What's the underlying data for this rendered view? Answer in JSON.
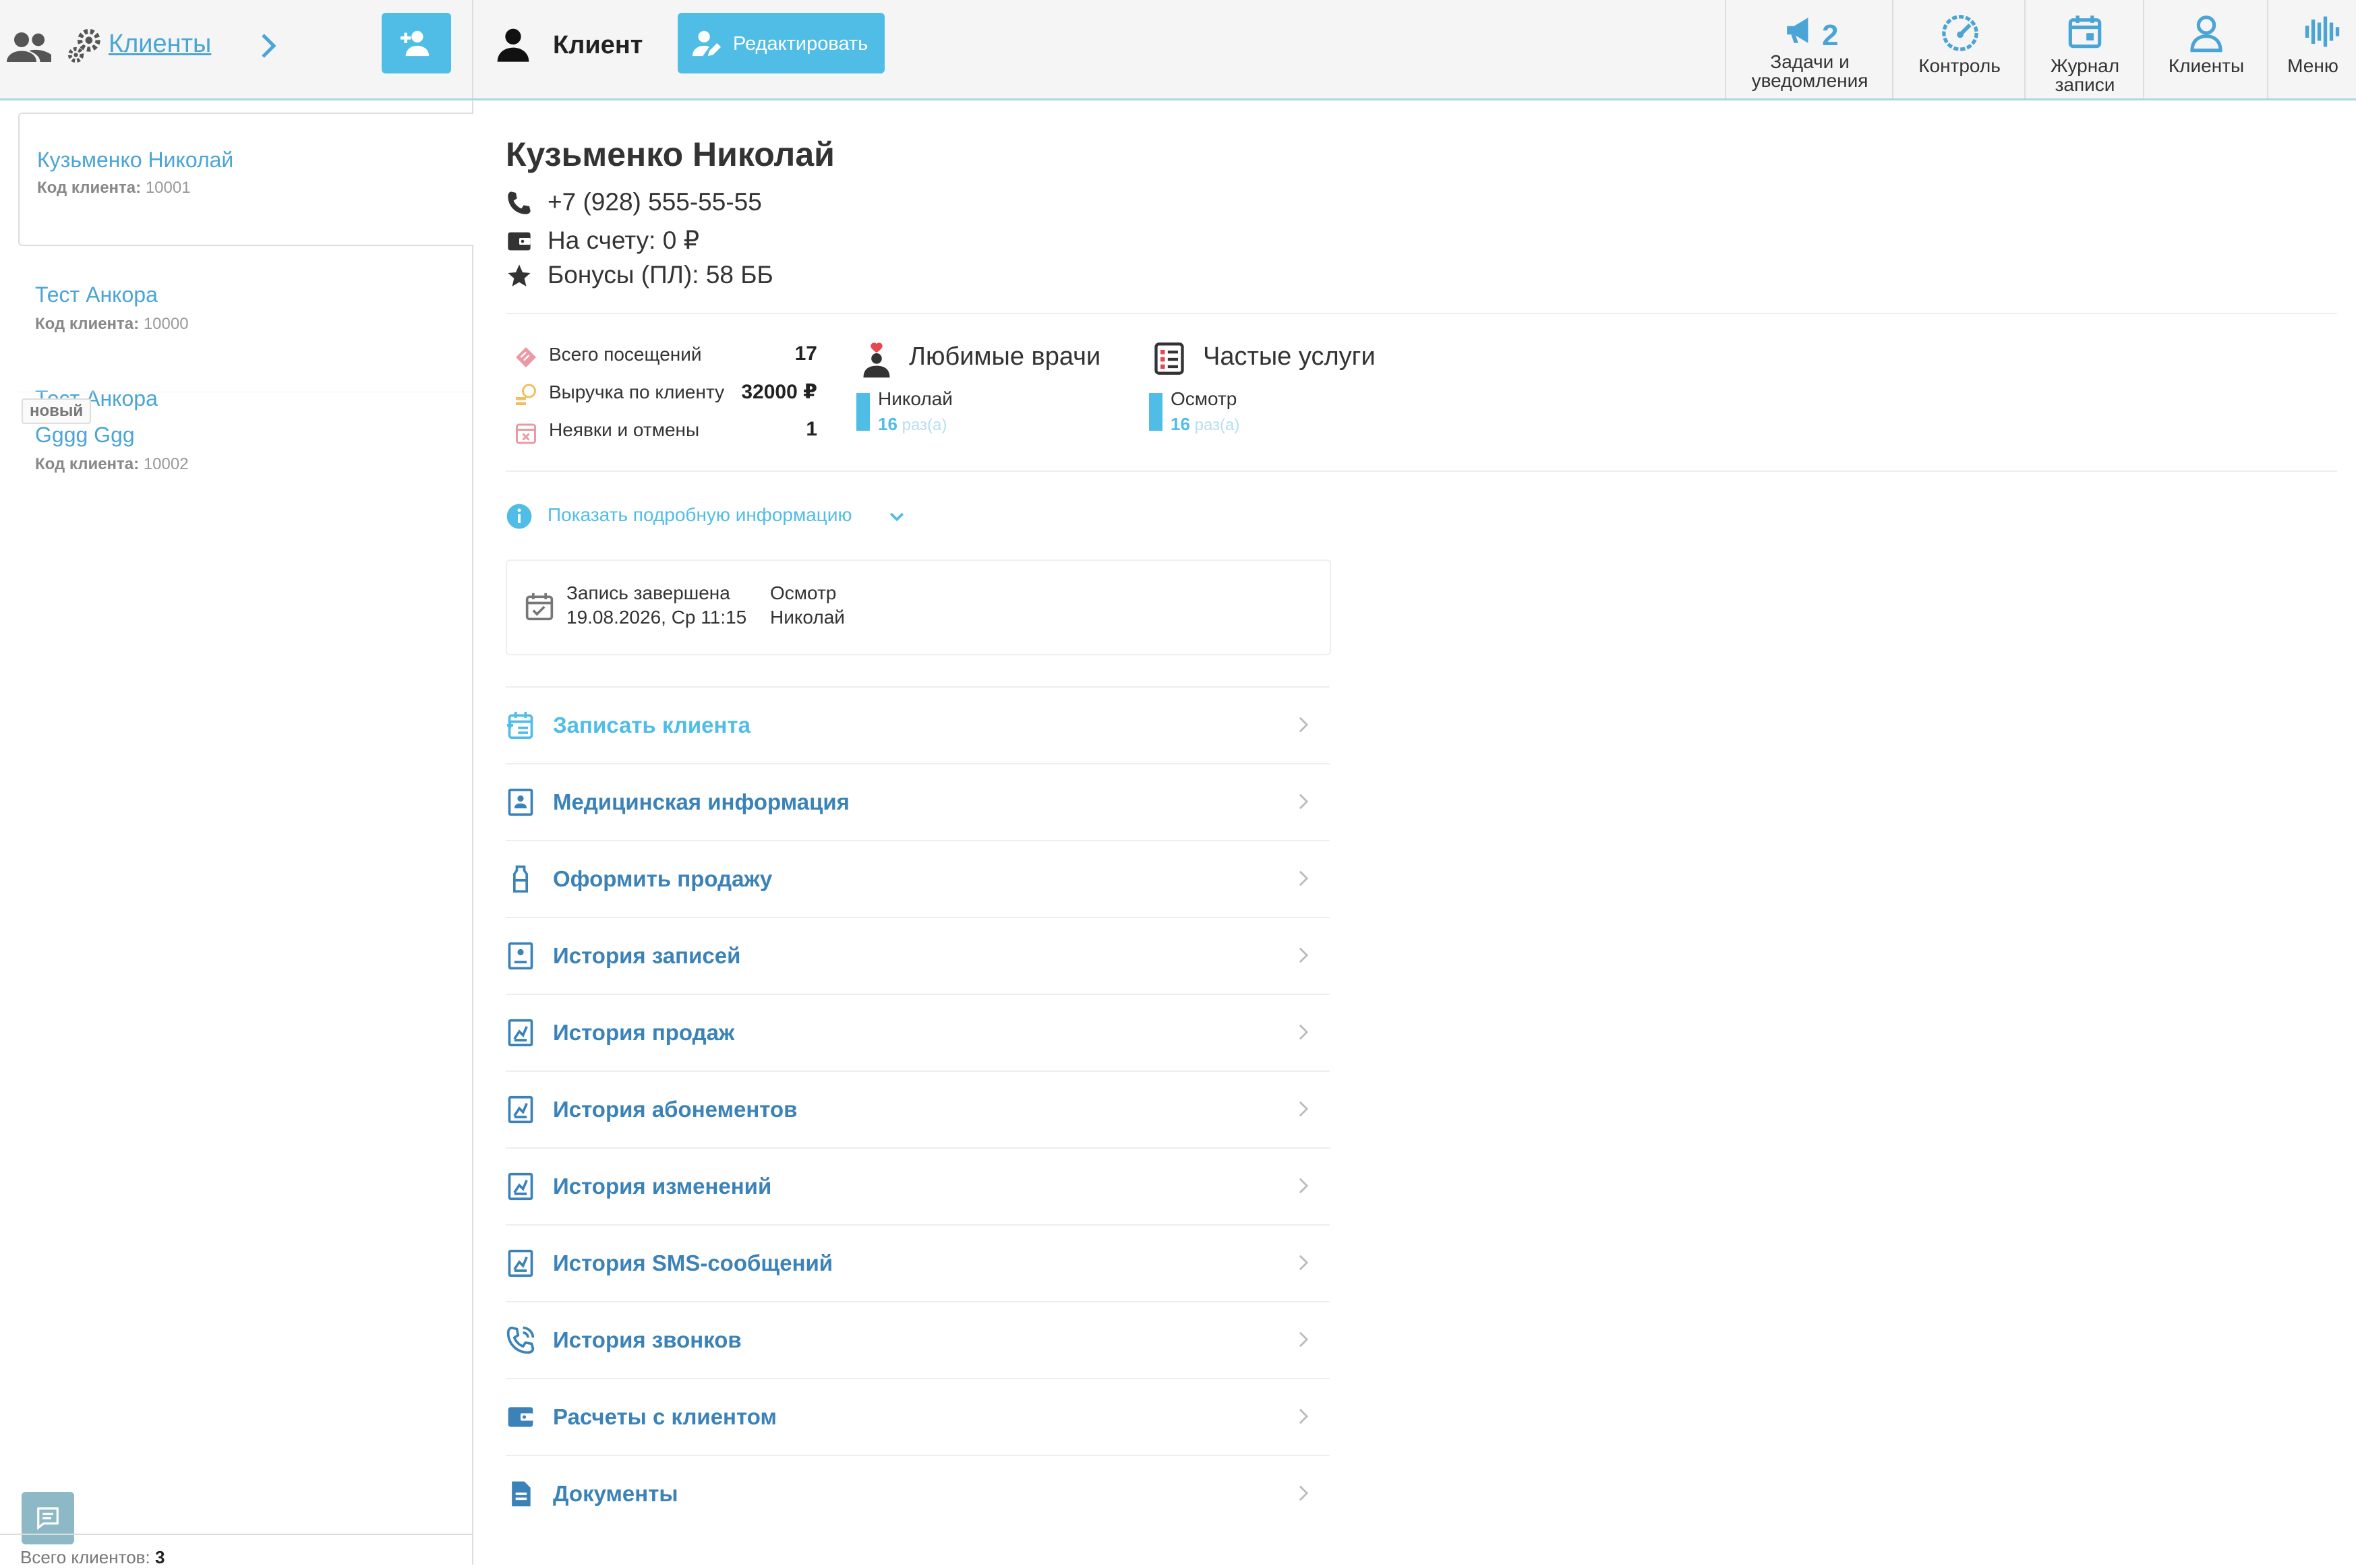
{
  "topbar": {
    "section_title": "Клиенты",
    "client_header": "Клиент",
    "edit_button": "Редактировать",
    "nav": {
      "tasks_count": "2",
      "tasks_line1": "Задачи и",
      "tasks_line2": "уведомления",
      "control": "Контроль",
      "journal_line1": "Журнал",
      "journal_line2": "записи",
      "clients": "Клиенты",
      "menu": "Меню"
    }
  },
  "sidebar": {
    "code_label": "Код клиента:",
    "clients": [
      {
        "name": "Кузьменко Николай",
        "code": "10001"
      },
      {
        "name": "Тест Анкора",
        "code": "10000"
      },
      {
        "name": "Gggg Ggg",
        "code": "10002",
        "badge": "новый"
      }
    ],
    "total_label": "Всего клиентов:",
    "total_value": "3"
  },
  "client": {
    "name": "Кузьменко Николай",
    "phone": "+7 (928) 555-55-55",
    "balance": "На счету: 0 ₽",
    "bonuses": "Бонусы (ПЛ): 58 ББ"
  },
  "stats": {
    "visits_label": "Всего посещений",
    "visits_value": "17",
    "revenue_label": "Выручка по клиенту",
    "revenue_value": "32000 ₽",
    "noshow_label": "Неявки и отмены",
    "noshow_value": "1"
  },
  "favorites": {
    "doctors_title": "Любимые врачи",
    "doctor_name": "Николай",
    "doctor_count": "16",
    "times_unit": "раз(а)",
    "services_title": "Частые услуги",
    "service_name": "Осмотр",
    "service_count": "16"
  },
  "show_more": "Показать подробную информацию",
  "appointment": {
    "status": "Запись завершена",
    "datetime": "19.08.2026, Ср 11:15",
    "service": "Осмотр",
    "doctor": "Николай"
  },
  "menu": [
    "Записать клиента",
    "Медицинская информация",
    "Оформить продажу",
    "История записей",
    "История продаж",
    "История абонементов",
    "История изменений",
    "История SMS-сообщений",
    "История звонков",
    "Расчеты с клиентом",
    "Документы"
  ],
  "colors": {
    "accent": "#50bde7",
    "link": "#3a82b8",
    "bar": "#50bde7"
  }
}
